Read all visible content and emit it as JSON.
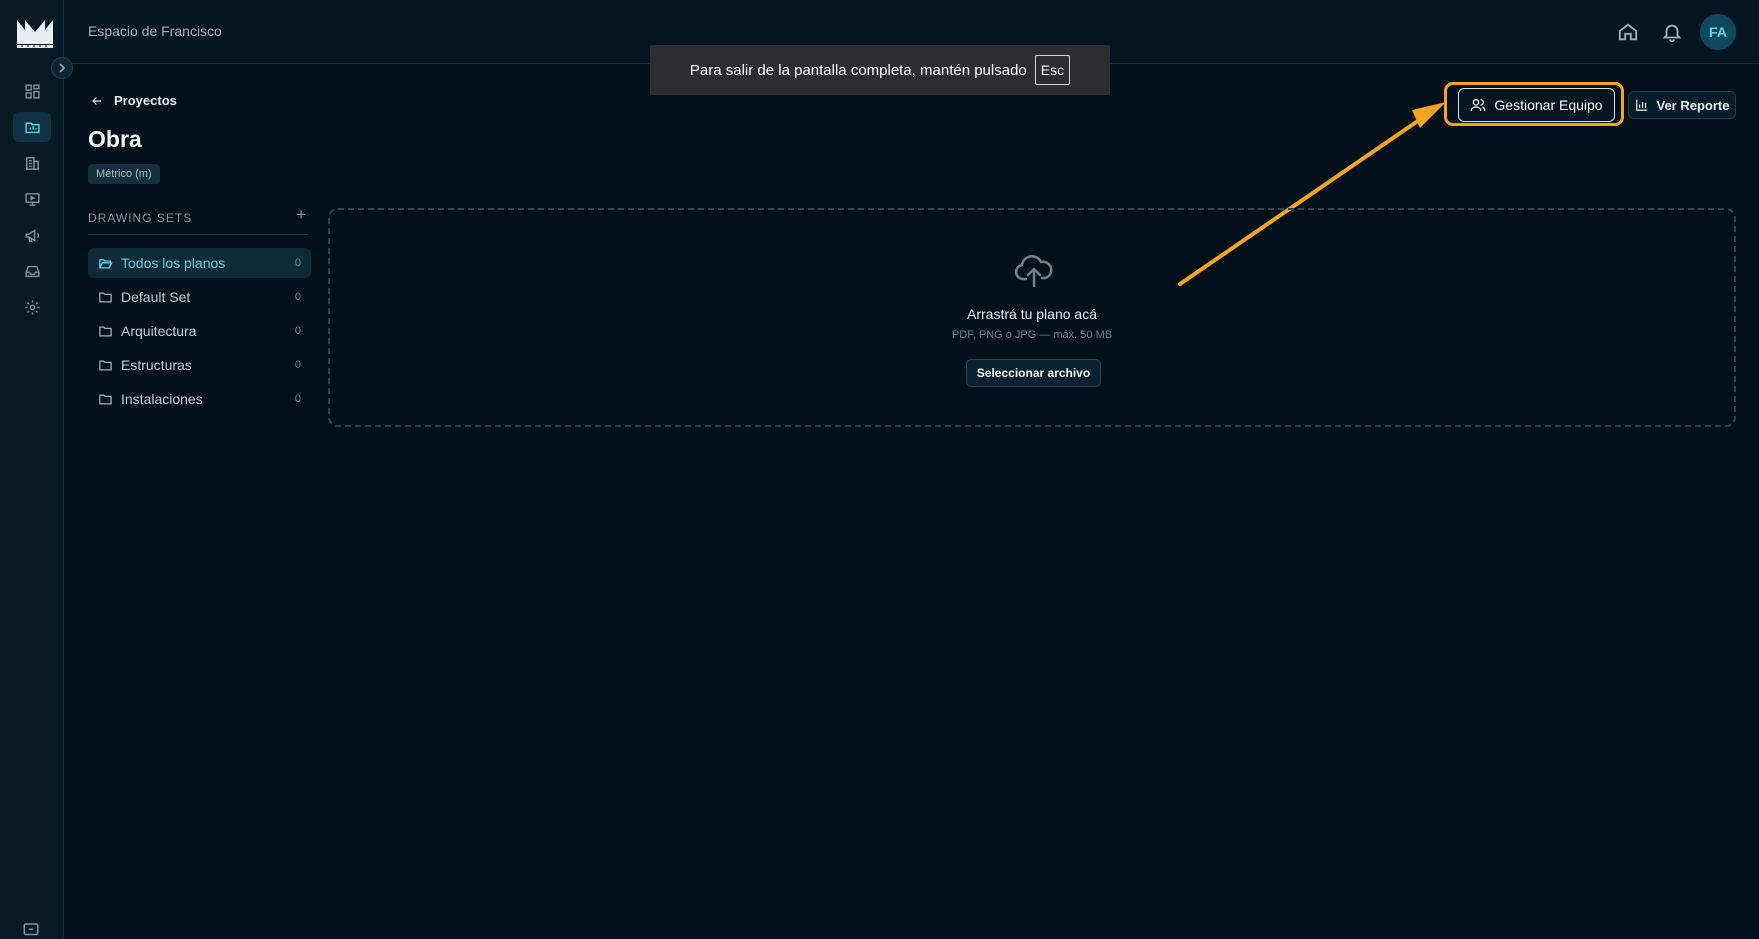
{
  "topbar": {
    "workspace_name": "Espacio de Francisco",
    "avatar_initials": "FA"
  },
  "toast": {
    "message": "Para salir de la pantalla completa, mantén pulsado",
    "key": "Esc"
  },
  "page": {
    "back_label": "Proyectos",
    "title": "Obra",
    "unit_badge": "Métrico (m)"
  },
  "actions": {
    "manage_team_label": "Gestionar Equipo",
    "report_label": "Ver Reporte",
    "highlight_color": "#f3a51f"
  },
  "drawing_sets": {
    "title": "DRAWING SETS",
    "add_label": "+",
    "items": [
      {
        "label": "Todos los planos",
        "count": "0"
      },
      {
        "label": "Default Set",
        "count": "0"
      },
      {
        "label": "Arquitectura",
        "count": "0"
      },
      {
        "label": "Estructuras",
        "count": "0"
      },
      {
        "label": "Instalaciones",
        "count": "0"
      }
    ]
  },
  "dropzone": {
    "title": "Arrastrá tu plano acá",
    "subtitle": "PDF, PNG o JPG — máx. 50 MB",
    "button_label": "Seleccionar archivo"
  },
  "sidebar": {
    "icons": [
      "dashboard-icon",
      "projects-icon",
      "buildings-icon",
      "presentation-icon",
      "megaphone-icon",
      "inbox-icon",
      "settings-icon"
    ]
  },
  "colors": {
    "accent": "#5fd4e9",
    "background": "#02101a"
  }
}
